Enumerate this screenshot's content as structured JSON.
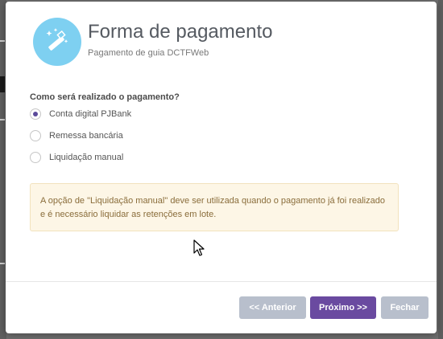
{
  "modal": {
    "title": "Forma de pagamento",
    "subtitle": "Pagamento de guia DCTFWeb",
    "icon": "magic-wand-icon",
    "icon_bg": "#7ed0f1"
  },
  "form": {
    "question": "Como será realizado o pagamento?",
    "options": [
      {
        "label": "Conta digital PJBank",
        "selected": true
      },
      {
        "label": "Remessa bancária",
        "selected": false
      },
      {
        "label": "Liquidação manual",
        "selected": false
      }
    ]
  },
  "alert": {
    "text": "A opção de \"Liquidação manual\" deve ser utilizada quando o pagamento já foi realizado e é necessário liquidar as retenções em lote."
  },
  "footer": {
    "prev_label": "<< Anterior",
    "next_label": "Próximo >>",
    "close_label": "Fechar",
    "accent": "#6a4aa0",
    "disabled_color": "#b8bfcc"
  }
}
